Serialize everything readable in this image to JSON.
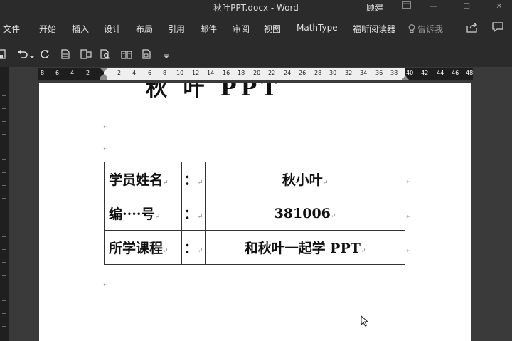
{
  "window": {
    "title": "秋叶PPT.docx  -  Word",
    "user": "顾建"
  },
  "ribbon": {
    "tabs": [
      "文件",
      "开始",
      "插入",
      "设计",
      "布局",
      "引用",
      "邮件",
      "审阅",
      "视图",
      "MathType",
      "福昕阅读器"
    ],
    "tell_me": "告诉我"
  },
  "ruler": {
    "left_numbers": [
      "8",
      "6",
      "4",
      "2"
    ],
    "right_numbers": [
      "2",
      "4",
      "6",
      "8",
      "10",
      "12",
      "14",
      "16",
      "18",
      "20",
      "22",
      "24",
      "26",
      "28",
      "30",
      "32",
      "34",
      "36",
      "38"
    ],
    "margin_numbers": [
      "40",
      "42",
      "44",
      "46",
      "48"
    ]
  },
  "document": {
    "heading_fragment": "秋 叶 PPT",
    "paragraph_mark": "↵",
    "table": [
      {
        "label": "学员姓名",
        "colon": "：",
        "value": "秋小叶"
      },
      {
        "label": "编····号",
        "colon": "：",
        "value": "381006"
      },
      {
        "label": "所学课程",
        "colon": "：",
        "value": "和秋叶一起学 PPT"
      }
    ]
  }
}
